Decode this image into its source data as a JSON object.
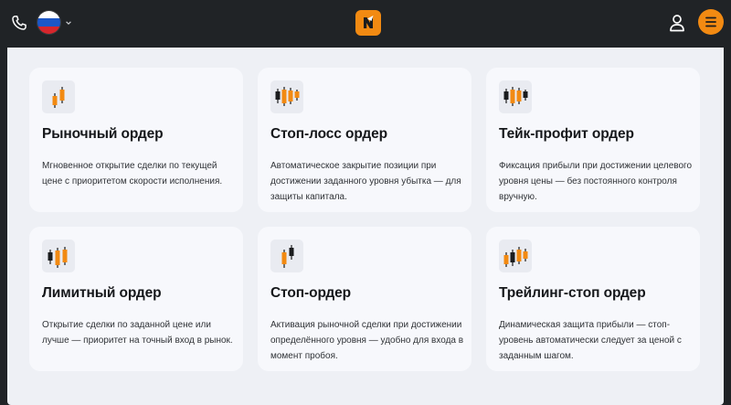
{
  "header": {
    "logo_icon": "trading-platform-logo",
    "phone_icon": "phone-icon",
    "language_icon": "russia-flag-icon",
    "user_icon": "user-icon",
    "menu_icon": "hamburger-menu-icon",
    "accent_color": "#f28a12"
  },
  "cards": [
    {
      "title": "Рыночный ордер",
      "description": "Мгновенное открытие сделки по текущей цене с приоритетом скорости исполнения.",
      "icon": "candlestick-icon"
    },
    {
      "title": "Стоп-лосс ордер",
      "description": "Автоматическое закрытие позиции при достижении заданного уровня убытка — для защиты капитала.",
      "icon": "candlestick-icon"
    },
    {
      "title": "Тейк-профит ордер",
      "description": "Фиксация прибыли при достижении целевого уровня цены — без постоянного контроля вручную.",
      "icon": "candlestick-icon"
    },
    {
      "title": "Лимитный ордер",
      "description": "Открытие сделки по заданной цене или лучше — приоритет на точный вход в рынок.",
      "icon": "candlestick-icon"
    },
    {
      "title": "Стоп-ордер",
      "description": "Активация рыночной сделки при достижении определённого уровня — удобно для входа в момент пробоя.",
      "icon": "candlestick-icon"
    },
    {
      "title": "Трейлинг-стоп ордер",
      "description": "Динамическая защита прибыли — стоп-уровень автоматически следует за ценой с заданным шагом.",
      "icon": "candlestick-icon"
    }
  ]
}
